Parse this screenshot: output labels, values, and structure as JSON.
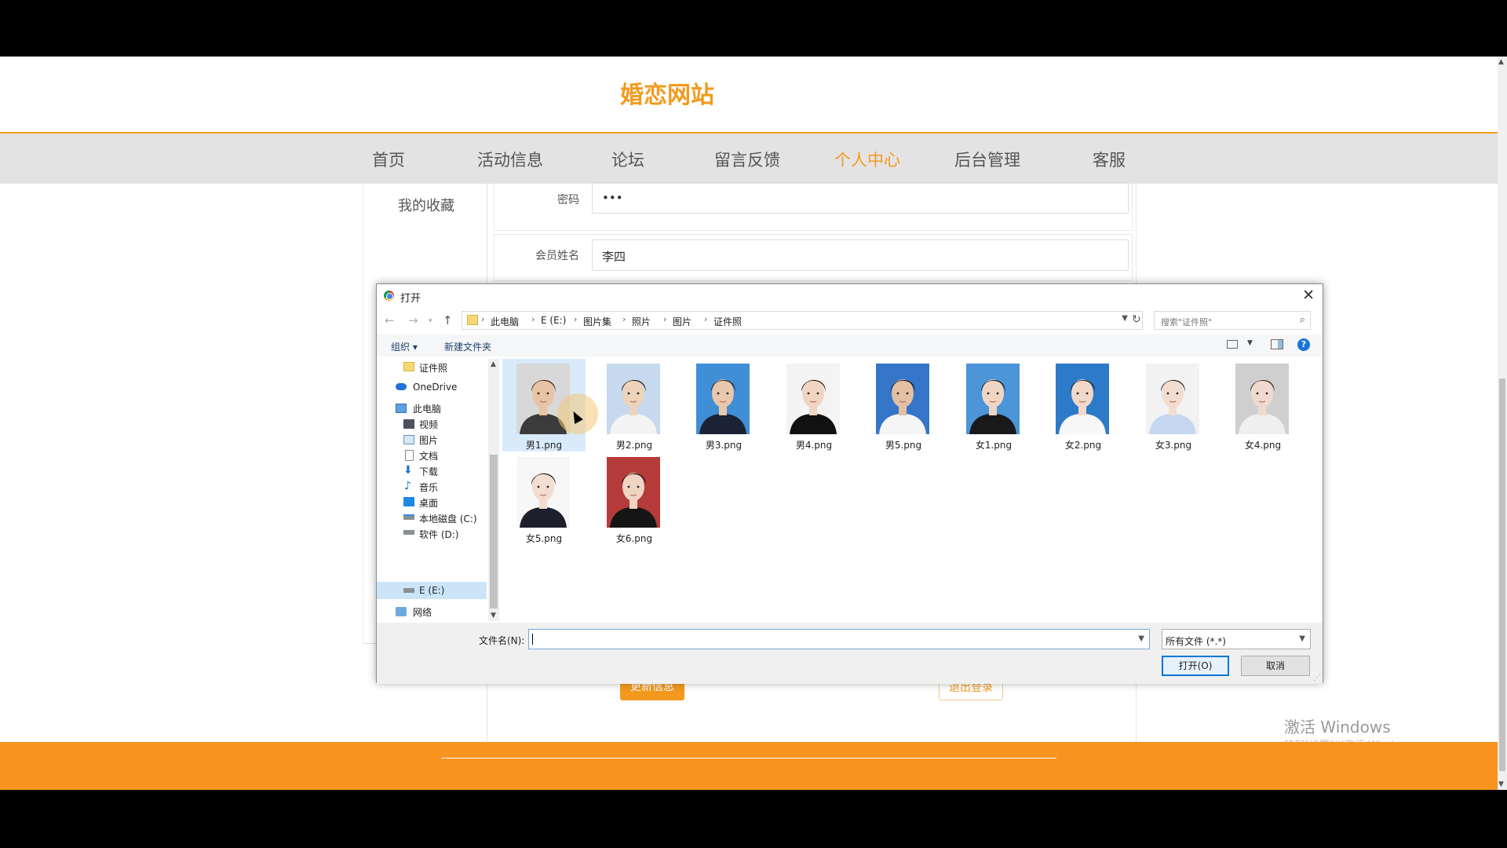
{
  "site": {
    "title": "婚恋网站"
  },
  "nav": {
    "items": [
      {
        "label": "首页"
      },
      {
        "label": "活动信息"
      },
      {
        "label": "论坛"
      },
      {
        "label": "留言反馈"
      },
      {
        "label": "个人中心"
      },
      {
        "label": "后台管理"
      },
      {
        "label": "客服"
      }
    ],
    "active": "个人中心"
  },
  "sidebar": {
    "favorites_label": "我的收藏"
  },
  "form": {
    "password_label": "密码",
    "password_value": "•••",
    "name_label": "会员姓名",
    "name_value": "李四",
    "update_button": "更新信息",
    "logout_button": "退出登录"
  },
  "watermark": {
    "title": "激活 Windows",
    "subtitle": "转到\"设置\"以激活 Windows。"
  },
  "dialog": {
    "title": "打开",
    "breadcrumbs": [
      "此电脑",
      "E (E:)",
      "图片集",
      "照片",
      "图片",
      "证件照"
    ],
    "search_placeholder": "搜索\"证件照\"",
    "toolbar": {
      "organize": "组织 ▾",
      "new_folder": "新建文件夹",
      "help": "?"
    },
    "tree": [
      {
        "label": "证件照",
        "icon": "folder-icon"
      },
      {
        "label": "OneDrive",
        "icon": "cloud-icon"
      },
      {
        "label": "此电脑",
        "icon": "computer-icon"
      },
      {
        "label": "视频",
        "icon": "video-icon"
      },
      {
        "label": "图片",
        "icon": "picture-icon"
      },
      {
        "label": "文档",
        "icon": "document-icon"
      },
      {
        "label": "下载",
        "icon": "download-icon"
      },
      {
        "label": "音乐",
        "icon": "music-icon"
      },
      {
        "label": "桌面",
        "icon": "desktop-icon"
      },
      {
        "label": "本地磁盘 (C:)",
        "icon": "drive-icon"
      },
      {
        "label": "软件 (D:)",
        "icon": "drive-icon"
      },
      {
        "label": "E (E:)",
        "icon": "drive-icon"
      },
      {
        "label": "网络",
        "icon": "network-icon"
      }
    ],
    "files": [
      {
        "name": "男1.png",
        "bg": "#d8d8d8",
        "hair": "#2a2118",
        "shirt": "#3b3b3b",
        "skin": "#e8c4a4"
      },
      {
        "name": "男2.png",
        "bg": "#c7d9ee",
        "hair": "#1a1411",
        "shirt": "#f4f4f4",
        "skin": "#edd2bc"
      },
      {
        "name": "男3.png",
        "bg": "#3f8ed6",
        "hair": "#2a1d14",
        "shirt": "#1b2233",
        "skin": "#e9c7ad"
      },
      {
        "name": "男4.png",
        "bg": "#f4f4f4",
        "hair": "#1d1715",
        "shirt": "#111111",
        "skin": "#efd5c2"
      },
      {
        "name": "男5.png",
        "bg": "#3576c9",
        "hair": "#151210",
        "shirt": "#f5f5f5",
        "skin": "#e4bfa2"
      },
      {
        "name": "女1.png",
        "bg": "#4b95d8",
        "hair": "#1f1712",
        "shirt": "#191919",
        "skin": "#f0d5c4"
      },
      {
        "name": "女2.png",
        "bg": "#2d7ac9",
        "hair": "#241913",
        "shirt": "#f7f7f7",
        "skin": "#f1d8c8"
      },
      {
        "name": "女3.png",
        "bg": "#f2f2f2",
        "hair": "#241a15",
        "shirt": "#c4d7ee",
        "skin": "#f2dccf"
      },
      {
        "name": "女4.png",
        "bg": "#cfcfcf",
        "hair": "#2a1f19",
        "shirt": "#efefef",
        "skin": "#f0d9ce"
      },
      {
        "name": "女5.png",
        "bg": "#f7f7f7",
        "hair": "#1c1512",
        "shirt": "#1e1f2c",
        "skin": "#f3ddd0"
      },
      {
        "name": "女6.png",
        "bg": "#b53a3a",
        "hair": "#1a1210",
        "shirt": "#151515",
        "skin": "#efd3c3"
      }
    ],
    "filename_label": "文件名(N):",
    "filename_value": "",
    "filetype_value": "所有文件 (*.*)",
    "open_button": "打开(O)",
    "cancel_button": "取消"
  },
  "colors": {
    "accent": "#f39a1e",
    "footer": "#f7931e",
    "nav_bg": "#e3e3e3"
  }
}
